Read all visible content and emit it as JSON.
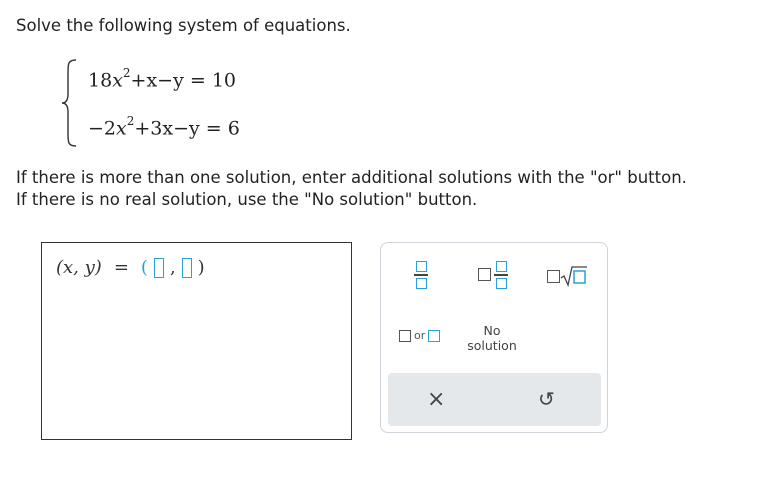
{
  "prompt": "Solve the following system of equations.",
  "equations": {
    "eq1": {
      "a": "18",
      "var1": "x",
      "exp": "2",
      "rest": "+x−y = 10"
    },
    "eq2": {
      "a": "−2",
      "var1": "x",
      "exp": "2",
      "rest": "+3x−y = 6"
    }
  },
  "info": [
    "If there is more than one solution, enter additional solutions with the \"or\" button.",
    "If there is no real solution, use the \"No solution\" button."
  ],
  "answer": {
    "label": "(x, y)",
    "equals": "=",
    "open": "(",
    "comma": ",",
    "close": ")"
  },
  "palette": {
    "or_label": "or",
    "no_solution_line1": "No",
    "no_solution_line2": "solution",
    "clear_symbol": "×",
    "undo_symbol": "↺"
  },
  "colors": {
    "accent": "#2a9fd8",
    "footer_bg": "#e5e8eb",
    "border": "#cfd4da"
  }
}
